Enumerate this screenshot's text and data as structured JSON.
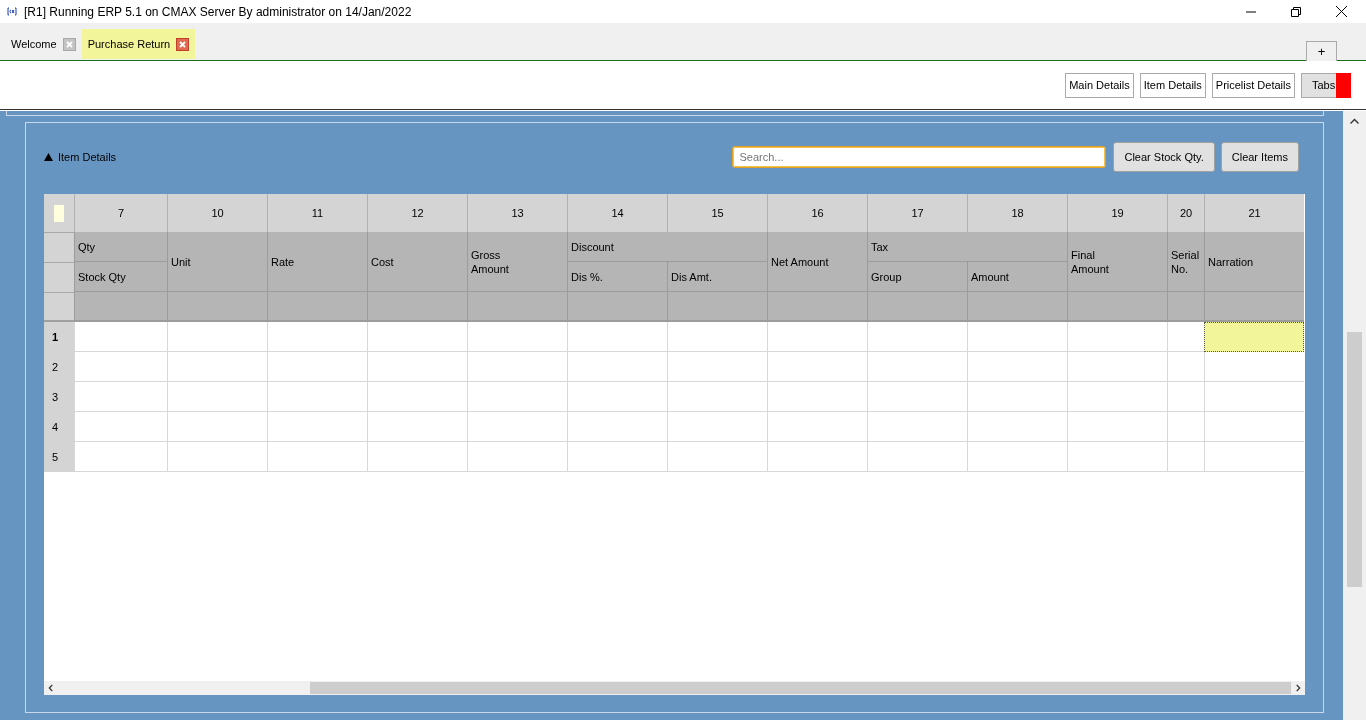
{
  "window": {
    "title": "[R1] Running ERP 5.1 on CMAX Server By administrator on 14/Jan/2022"
  },
  "tabs": [
    {
      "label": "Welcome",
      "selected": false
    },
    {
      "label": "Purchase Return",
      "selected": true
    }
  ],
  "new_tab": "+",
  "toolbar_buttons": [
    {
      "label": "Main Details",
      "kind": "plain"
    },
    {
      "label": "Item Details",
      "kind": "plain"
    },
    {
      "label": "Pricelist Details",
      "kind": "plain"
    },
    {
      "label": "Tabs",
      "kind": "toggle"
    }
  ],
  "section": {
    "title": "Item Details",
    "expanded": true,
    "search": {
      "placeholder": "Search..."
    },
    "buttons": [
      "Clear Stock Qty.",
      "Clear Items"
    ]
  },
  "grid": {
    "columns": [
      "7",
      "10",
      "11",
      "12",
      "13",
      "14",
      "15",
      "16",
      "17",
      "18",
      "19",
      "20",
      "21"
    ],
    "headers": [
      {
        "label": "Qty",
        "children": [
          "Stock Qty"
        ]
      },
      {
        "label": "Unit"
      },
      {
        "label": "Rate"
      },
      {
        "label": "Cost"
      },
      {
        "label": "Gross Amount"
      },
      {
        "label": "Discount",
        "children": [
          "Dis %.",
          "Dis Amt."
        ]
      },
      {
        "label": "Net Amount"
      },
      {
        "label": "Tax",
        "children": [
          "Group",
          "Amount"
        ]
      },
      {
        "label": "Final Amount"
      },
      {
        "label": "Serial No."
      },
      {
        "label": "Narration"
      }
    ],
    "rows": [
      {
        "label": "1",
        "selected": true
      },
      {
        "label": "2",
        "selected": false
      },
      {
        "label": "3",
        "selected": false
      },
      {
        "label": "4",
        "selected": false
      },
      {
        "label": "5",
        "selected": false
      }
    ]
  }
}
